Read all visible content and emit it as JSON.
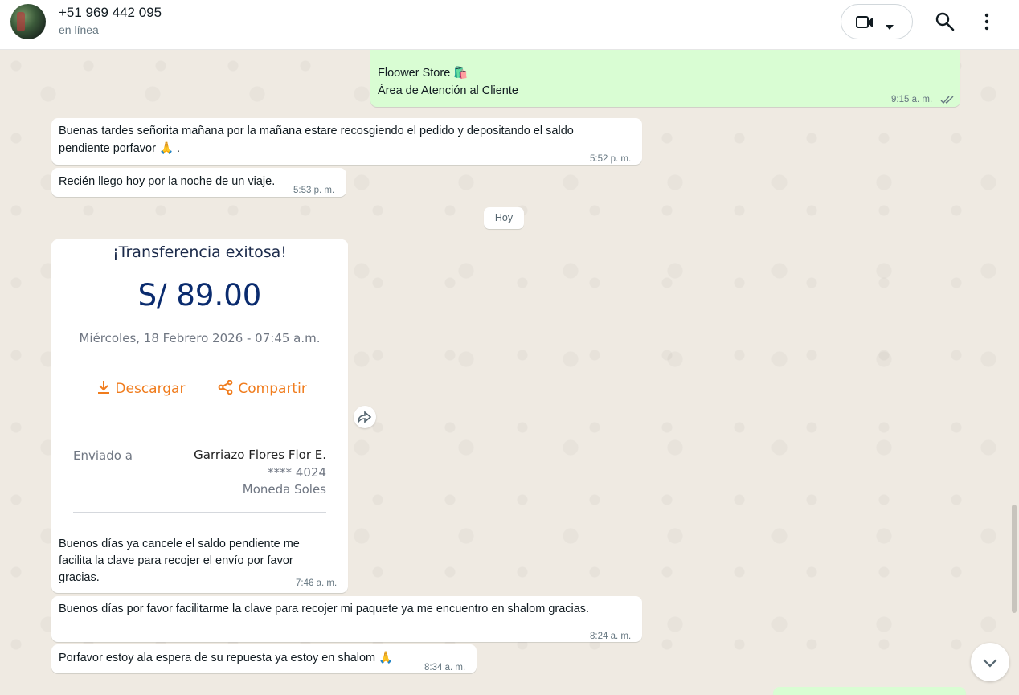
{
  "header": {
    "contact_name": "+51 969 442 095",
    "contact_status": "en línea",
    "icons": {
      "video": "video-camera-icon",
      "dropdown": "chevron-down-icon",
      "search": "search-icon",
      "menu": "more-vertical-icon"
    }
  },
  "messages": [
    {
      "direction": "out",
      "line1": "Floower Store 🛍️",
      "line2": "Área de Atención al Cliente",
      "time": "9:15 a. m.",
      "status": "read"
    },
    {
      "direction": "in",
      "line1": "Buenas tardes señorita mañana por la mañana estare recosgiendo el pedido y depositando el saldo",
      "line2": "pendiente porfavor 🙏 .",
      "time": "5:52 p. m."
    },
    {
      "direction": "in",
      "line1": "Recién llego hoy por la noche de un viaje.",
      "time": "5:53 p. m."
    }
  ],
  "date_chip": "Hoy",
  "receipt": {
    "title": "¡Transferencia exitosa!",
    "amount": "S/ 89.00",
    "date": "Miércoles, 18 Febrero 2026 - 07:45 a.m.",
    "download_label": "Descargar",
    "share_label": "Compartir",
    "sent_to_label": "Enviado a",
    "recipient_name": "Garriazo Flores Flor E.",
    "account": "**** 4024",
    "currency": "Moneda Soles",
    "caption_lines": [
      "Buenos días ya cancele el saldo pendiente me",
      "facilita la clave para recojer el envío por favor",
      "gracias."
    ],
    "time": "7:46 a. m.",
    "accent_color": "#f07c1d",
    "amount_color": "#0a2b6e"
  },
  "later_messages": [
    {
      "direction": "in",
      "text": "Buenos días por favor facilitarme la clave para recojer mi paquete ya me encuentro en shalom gracias.",
      "time": "8:24 a. m."
    },
    {
      "direction": "in",
      "text": "Porfavor estoy ala espera de su repuesta ya estoy en shalom 🙏",
      "time": "8:34 a. m."
    }
  ],
  "colors": {
    "outgoing_bubble": "#d9fdd3",
    "incoming_bubble": "#ffffff",
    "chat_background": "#efeae2"
  }
}
